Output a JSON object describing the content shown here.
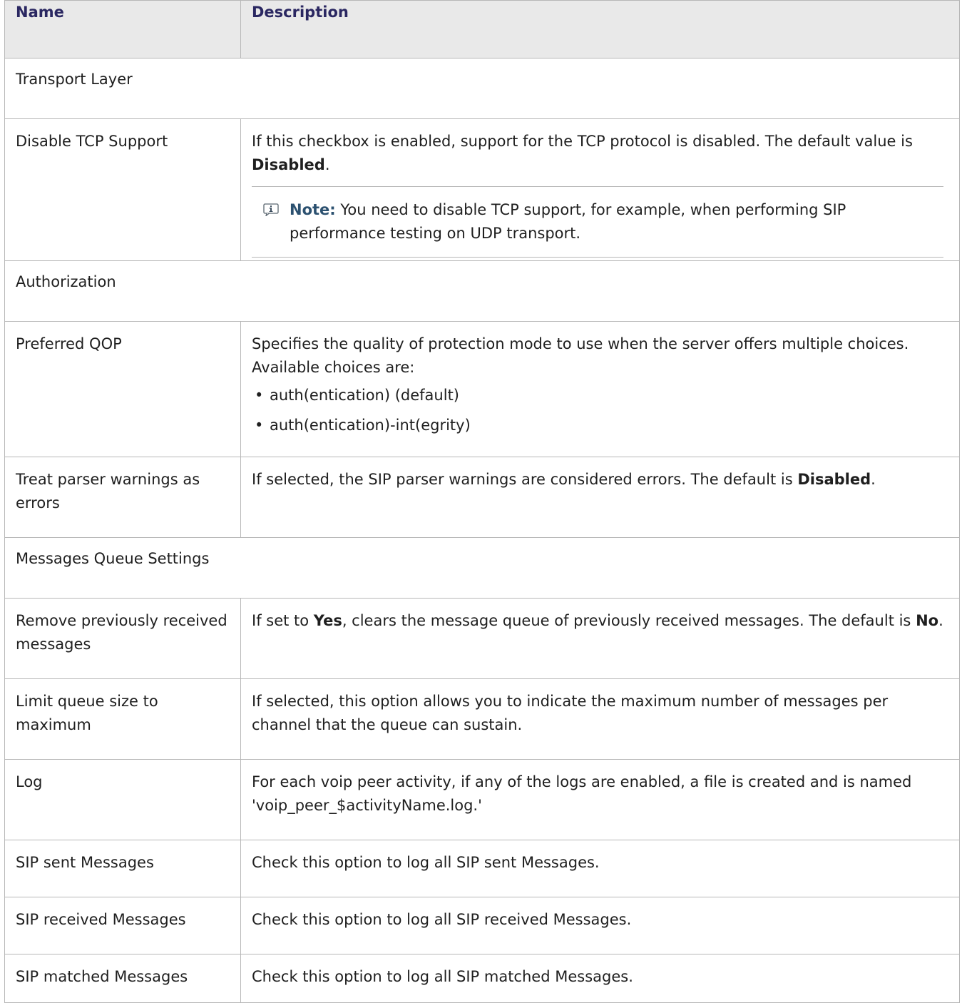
{
  "header": {
    "name": "Name",
    "description": "Description"
  },
  "sections": {
    "transport": "Transport Layer",
    "authorization": "Authorization",
    "queue": "Messages Queue Settings"
  },
  "rows": {
    "tcp": {
      "name": "Disable TCP Support",
      "desc_pre": "If this checkbox is enabled, support for the TCP protocol is disabled. The default value is ",
      "desc_bold": "Disabled",
      "desc_post": ".",
      "note_label": "Note:",
      "note_text": " You need to disable TCP support, for example, when performing SIP performance testing on UDP transport."
    },
    "qop": {
      "name": "Preferred QOP",
      "desc": "Specifies the quality of protection mode to use when the server offers multiple choices. Available choices are:",
      "choices": [
        "auth(entication) (default)",
        "auth(entication)-int(egrity)"
      ]
    },
    "warnings": {
      "name": "Treat parser warnings as errors",
      "desc_pre": "If selected, the SIP parser warnings are considered errors. The default is ",
      "desc_bold": "Disabled",
      "desc_post": "."
    },
    "remove": {
      "name": "Remove previously received messages",
      "desc_1": "If set to ",
      "desc_bold_1": "Yes",
      "desc_2": ", clears the message queue of previously received messages. The default is ",
      "desc_bold_2": "No",
      "desc_3": "."
    },
    "limit": {
      "name": "Limit queue size to maximum",
      "desc": "If selected, this option allows you to indicate the maximum number of messages per channel that the queue can sustain."
    },
    "log": {
      "name": "Log",
      "desc": "For each voip peer activity, if any of the logs are enabled, a file is created and is named 'voip_peer_$activityName.log.'"
    },
    "sent": {
      "name": "SIP sent Messages",
      "desc": "Check this option to log all SIP sent Messages."
    },
    "received": {
      "name": "SIP received Messages",
      "desc": "Check this option to log all SIP received Messages."
    },
    "matched": {
      "name": "SIP matched Messages",
      "desc": "Check this option to log all SIP matched Messages."
    }
  },
  "icons": {
    "note": "info-note-icon",
    "bullet": "•"
  },
  "colors": {
    "header_bg": "#e9e9e9",
    "header_text": "#2a2761",
    "note_label": "#2c5170",
    "border": "#b7b7b7"
  }
}
